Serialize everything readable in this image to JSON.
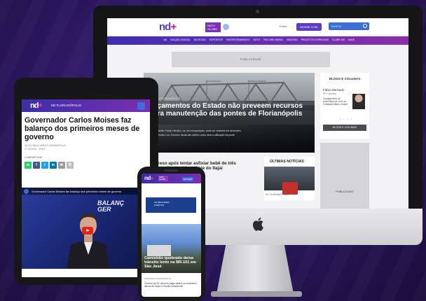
{
  "desktop": {
    "header": {
      "logo": "nd",
      "logo_plus": "+",
      "logo_tag": "NDTV GLOBO",
      "entrar": "Entrar",
      "assine": "ASSINE O ND",
      "search_placeholder": "BUSCA"
    },
    "nav": [
      "ND",
      "EDIÇÃO DIGITAL",
      "NOTÍCIAS",
      "ESPORTES",
      "ENTRETENIMENTO",
      "NDTV",
      "RECORD NEWS",
      "VIAGENS",
      "PROJETOS ESPECIAIS",
      "CLUBE ND",
      "MAIS"
    ],
    "ad_label": "PUBLICIDADE",
    "hero": {
      "category": "GRANDE FLORIANÓPOLIS",
      "title": "Orçamentos do Estado não preveem recursos para manutenção das pontes de Florianópolis",
      "bullets": [
        "Fábio Gadotti: Ponte Hercílio Luz, em recuperação, pode ser reaberta em dezembro",
        "Ponte Hercílio Luz: Governo ainda não definiu como será a utilização da ponte"
      ]
    },
    "news": {
      "category": "GERAL",
      "title": "Pai é preso após tentar asfixiar bebê de três meses em Camboriú, no Vale do Itajaí",
      "desc": "Criança foi socorrida por familiares; bebê"
    },
    "ultimas": {
      "title": "ÚLTIMAS NOTÍCIAS",
      "category": "SC FLORIANÓPOLIS"
    },
    "blogs": {
      "title": "BLOGS E COLUNAS",
      "author": "Fábio Machado",
      "role": "ND Colunista",
      "text": "Cepagamento na Assembleia de Judo da Fundação Milton Goulart",
      "button": "BLOGS E COLUNAS"
    },
    "publicidade": "PUBLICIDADE"
  },
  "tablet": {
    "logo": "nd",
    "logo_plus": "+",
    "section": "ND FLORIANÓPOLIS",
    "title": "Governador Carlos Moises faz balanço dos primeiros meses de governo",
    "byline_1": "SILVIO MELO MIRA FLORIANÓPOLIS",
    "byline_2": "27.05.2019 - 20h03",
    "share_label": "COMPARTILHE",
    "share_icons": [
      "whatsapp-icon",
      "facebook-icon",
      "twitter-icon",
      "linkedin-icon",
      "email-icon",
      "link-icon"
    ],
    "video": {
      "caption": "Governador Carlos Moises faz balanço dos primeiros meses de governo",
      "bg_text_1": "BALANÇ",
      "bg_text_2": "GER",
      "bg_badge": "SC"
    }
  },
  "phone": {
    "logo": "nd",
    "logo_plus": "+",
    "tag": "NDTV GLOBO",
    "entrar": "ENTRAR",
    "ad_text": "AS MELHORES OFERTAS",
    "hero_title": "Caminhão quebrado deixa trânsito lento na BR-101 em São José",
    "category": "GRANDE FLORIANÓPOLIS",
    "text": "Governo de SC deixa de pagar salário do docentes e alunos da Saúde e Escola Catarinense"
  },
  "colors": {
    "brand_purple": "#5a3cc8",
    "brand_pink": "#e5185d",
    "search_blue": "#3b6fd6",
    "background": "#2c1760"
  }
}
